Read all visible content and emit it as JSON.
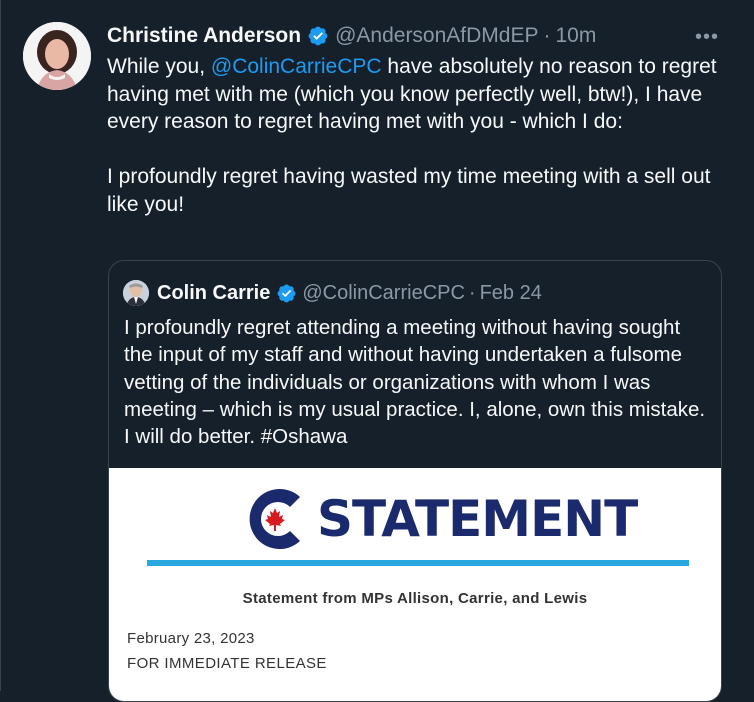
{
  "tweet": {
    "author_name": "Christine Anderson",
    "handle": "@AndersonAfDMdEP",
    "separator": "·",
    "time": "10m",
    "more_label": "•••",
    "text": {
      "prefix": "While you, ",
      "mention": "@ColinCarrieCPC",
      "line1_rest": " have absolutely no reason to regret having met with me (which you know perfectly well, btw!), I have every reason to regret having met with you - which I do:",
      "line2": "I profoundly regret having wasted my time meeting with a sell out like you!"
    }
  },
  "quoted_tweet": {
    "author_name": "Colin Carrie",
    "handle": "@ColinCarrieCPC",
    "separator": "·",
    "date": "Feb 24",
    "text": "I profoundly regret attending a meeting without having sought the input of my staff and without having undertaken a fulsome vetting of the individuals or organizations with whom I was meeting – which is my usual practice. I, alone, own this mistake. I will do better. ",
    "hashtag": "#Oshawa",
    "media": {
      "wordmark": "STATEMENT",
      "title": "Statement from MPs Allison, Carrie, and Lewis",
      "date": "February 23, 2023",
      "release": "FOR IMMEDIATE RELEASE"
    }
  },
  "colors": {
    "background": "#15202b",
    "link": "#1d9bf0",
    "verified": "#1d9bf0",
    "secondary_text": "#8b98a5",
    "logo_navy": "#1a2a6c",
    "logo_red": "#d71920",
    "accent_bar": "#29a8df"
  },
  "icons": {
    "verified": "verified-badge-icon",
    "more": "more-options-icon",
    "maple_leaf": "maple-leaf-icon"
  }
}
